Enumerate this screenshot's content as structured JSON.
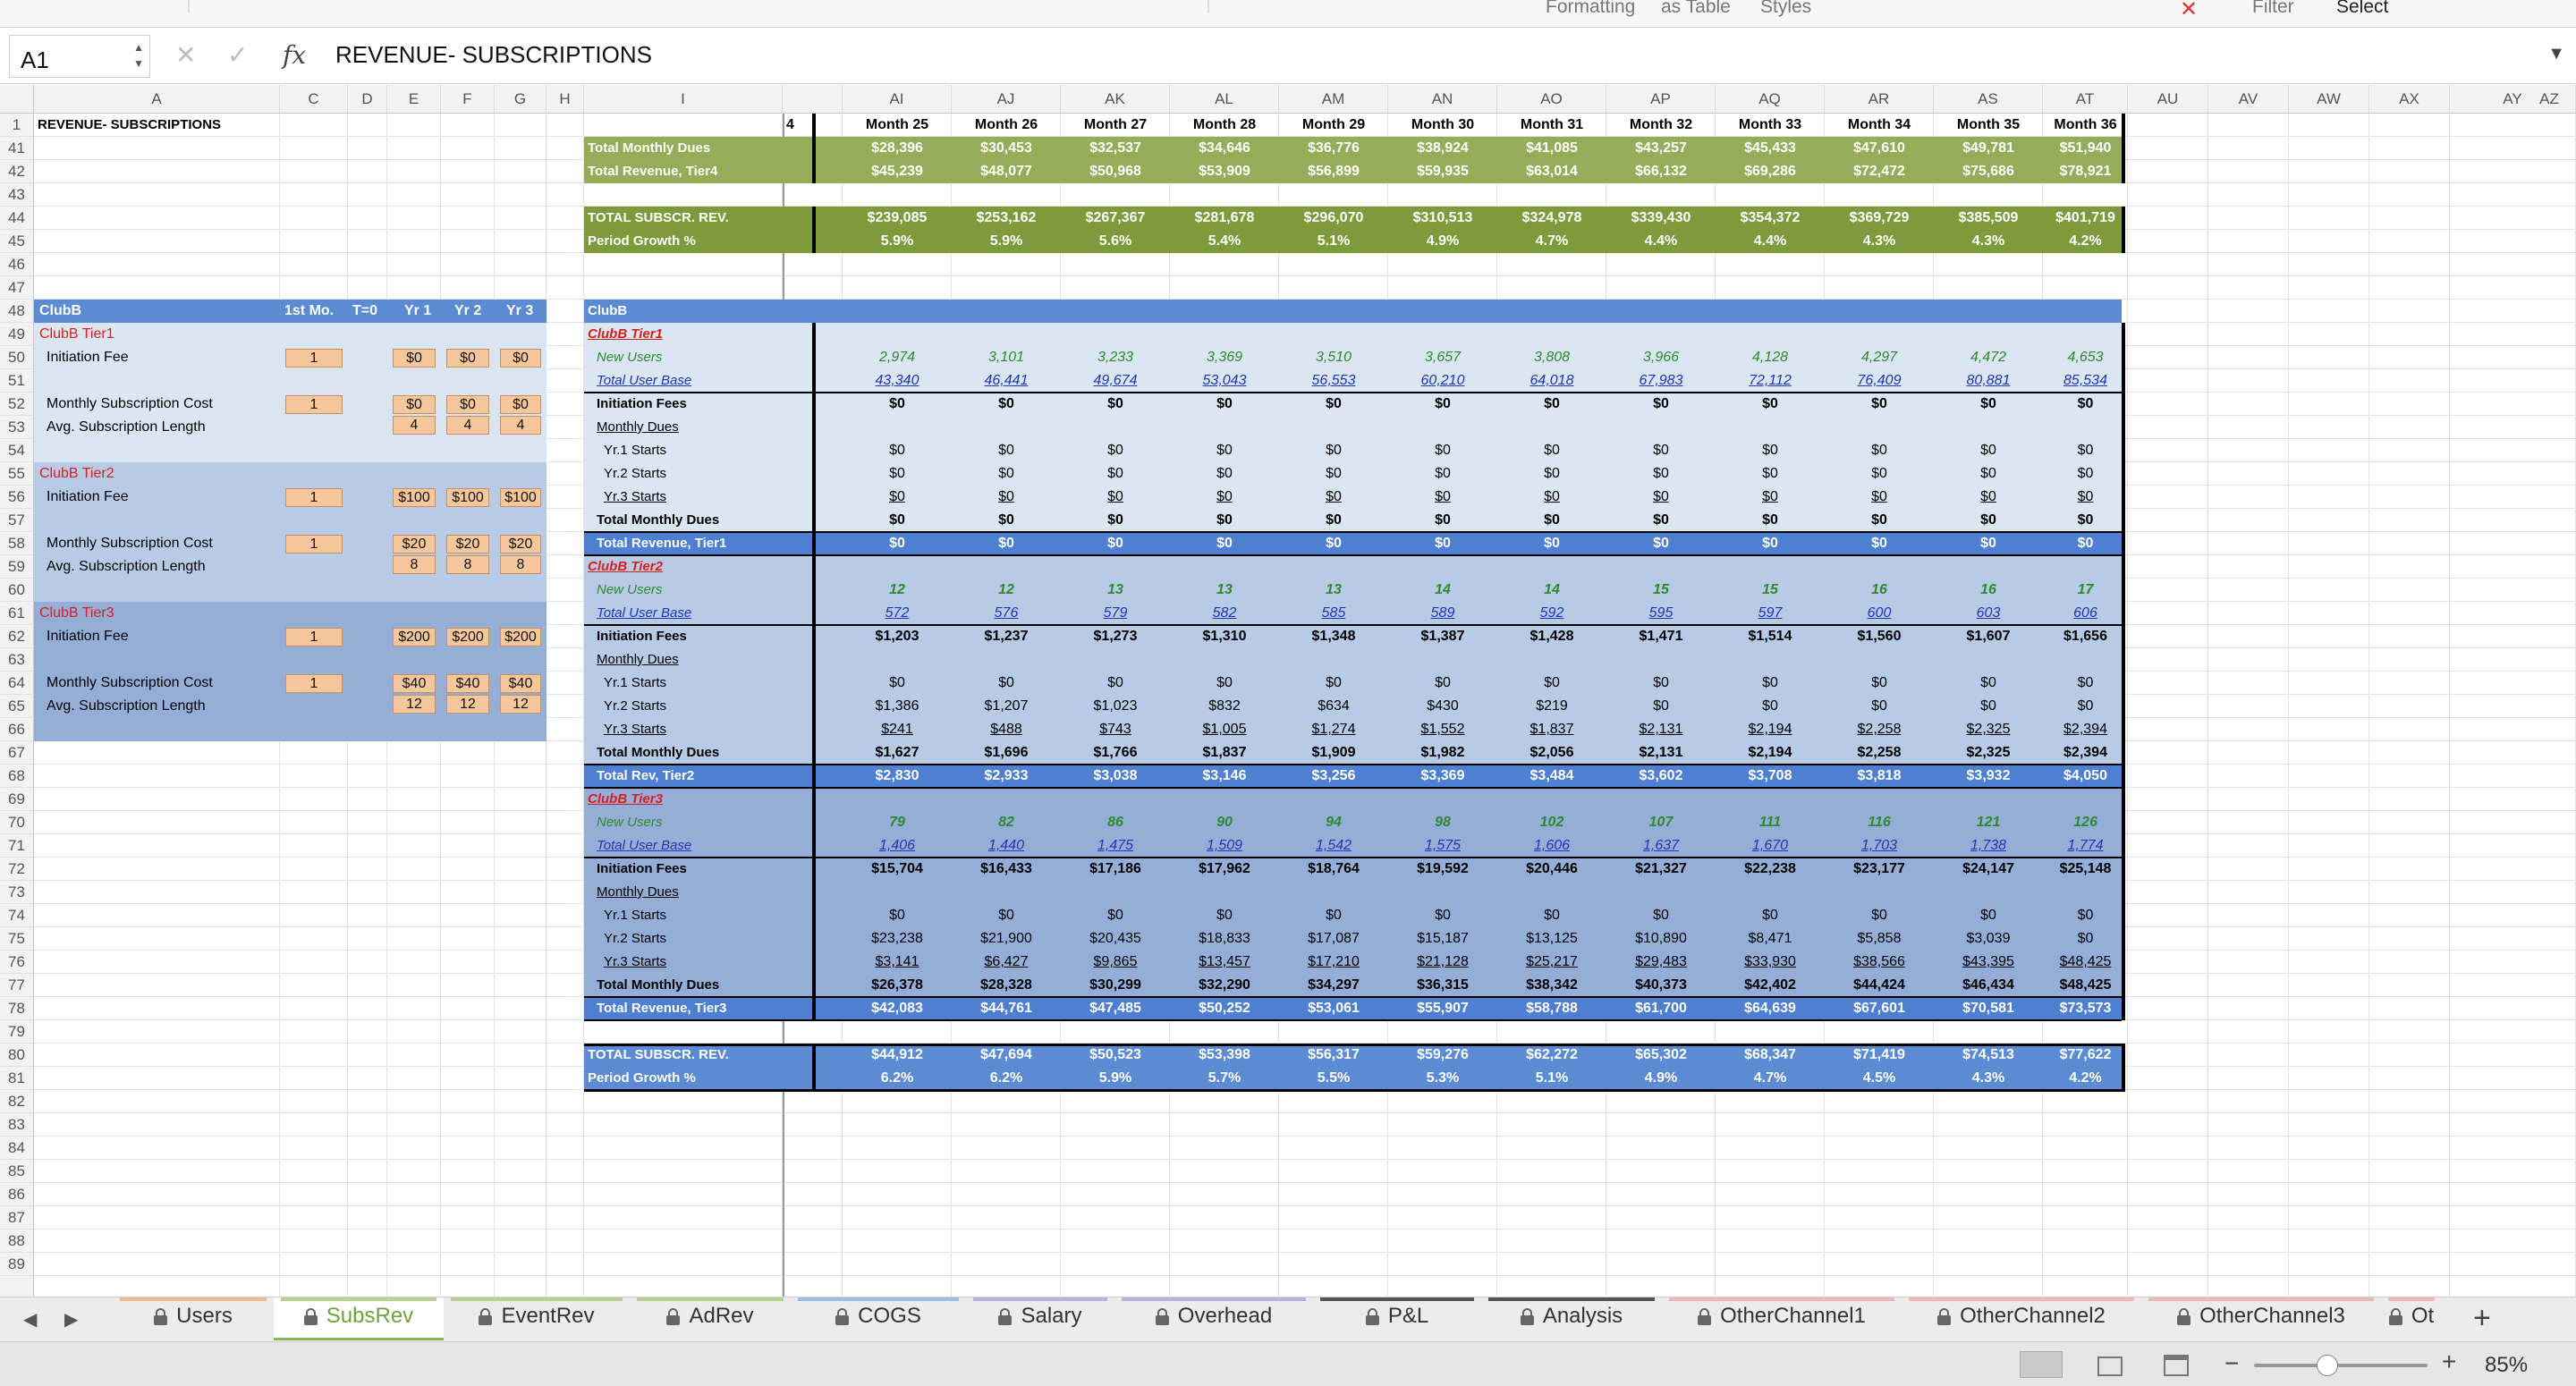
{
  "ribbon": {
    "formatting": "Formatting",
    "as_table": "as Table",
    "styles": "Styles",
    "filter": "Filter",
    "select": "Select"
  },
  "formula_bar": {
    "name_box": "A1",
    "formula": "REVENUE- SUBSCRIPTIONS"
  },
  "columns": [
    "A",
    "C",
    "D",
    "E",
    "F",
    "G",
    "H",
    "I",
    "AI",
    "AJ",
    "AK",
    "AL",
    "AM",
    "AN",
    "AO",
    "AP",
    "AQ",
    "AR",
    "AS",
    "AT",
    "AU",
    "AV",
    "AW",
    "AX",
    "AY",
    "AZ"
  ],
  "rows": [
    "1",
    "41",
    "42",
    "43",
    "44",
    "45",
    "46",
    "47",
    "48",
    "49",
    "50",
    "51",
    "52",
    "53",
    "54",
    "55",
    "56",
    "57",
    "58",
    "59",
    "60",
    "61",
    "62",
    "63",
    "64",
    "65",
    "66",
    "67",
    "68",
    "69",
    "70",
    "71",
    "72",
    "73",
    "74",
    "75",
    "76",
    "77",
    "78",
    "79",
    "80",
    "81",
    "82",
    "83",
    "84",
    "85",
    "86",
    "87",
    "88",
    "89"
  ],
  "sheet_title": "REVENUE- SUBSCRIPTIONS",
  "headers": {
    "months": [
      "Month 25",
      "Month 26",
      "Month 27",
      "Month 28",
      "Month 29",
      "Month 30",
      "Month 31",
      "Month 32",
      "Month 33",
      "Month 34",
      "Month 35",
      "Month 36"
    ],
    "col_h_label": "4"
  },
  "left_panel": {
    "title": "ClubB",
    "col_1st": "1st Mo.",
    "col_t0": "T=0",
    "col_yr1": "Yr 1",
    "col_yr2": "Yr 2",
    "col_yr3": "Yr 3",
    "tier1": "ClubB Tier1",
    "tier2": "ClubB Tier2",
    "tier3": "ClubB Tier3",
    "init_fee": "Initiation Fee",
    "monthly_cost": "Monthly Subscription Cost",
    "avg_length": "Avg. Subscription Length",
    "t1": {
      "init": [
        "1",
        "$0",
        "$0",
        "$0"
      ],
      "monthly": [
        "1",
        "$0",
        "$0",
        "$0"
      ],
      "length": [
        "4",
        "4",
        "4"
      ]
    },
    "t2": {
      "init": [
        "1",
        "$100",
        "$100",
        "$100"
      ],
      "monthly": [
        "1",
        "$20",
        "$20",
        "$20"
      ],
      "length": [
        "8",
        "8",
        "8"
      ]
    },
    "t3": {
      "init": [
        "1",
        "$200",
        "$200",
        "$200"
      ],
      "monthly": [
        "1",
        "$40",
        "$40",
        "$40"
      ],
      "length": [
        "12",
        "12",
        "12"
      ]
    }
  },
  "labels": {
    "r41": "Total Monthly Dues",
    "r42": "Total Revenue, Tier4",
    "r44": "TOTAL SUBSCR. REV.",
    "r45": "Period Growth %",
    "r48": "ClubB",
    "r49": "ClubB Tier1",
    "r50": "New Users",
    "r51": "Total User Base",
    "r52": "Initiation Fees",
    "r53": "Monthly Dues",
    "r54": "Yr.1 Starts",
    "r55": "Yr.2 Starts",
    "r56": "Yr.3 Starts",
    "r57": "Total Monthly Dues",
    "r58": "Total Revenue, Tier1",
    "r59": "ClubB Tier2",
    "r60": "New Users",
    "r61": "Total User Base",
    "r62": "Initiation Fees",
    "r63": "Monthly Dues",
    "r64": "Yr.1 Starts",
    "r65": "Yr.2 Starts",
    "r66": "Yr.3 Starts",
    "r67": "Total Monthly Dues",
    "r68": "Total Rev, Tier2",
    "r69": "ClubB Tier3",
    "r70": "New Users",
    "r71": "Total User Base",
    "r72": "Initiation Fees",
    "r73": "Monthly Dues",
    "r74": "Yr.1 Starts",
    "r75": "Yr.2 Starts",
    "r76": "Yr.3 Starts",
    "r77": "Total Monthly Dues",
    "r78": "Total Revenue, Tier3",
    "r80": "TOTAL SUBSCR. REV.",
    "r81": "Period Growth %"
  },
  "values": {
    "r41": [
      "$28,396",
      "$30,453",
      "$32,537",
      "$34,646",
      "$36,776",
      "$38,924",
      "$41,085",
      "$43,257",
      "$45,433",
      "$47,610",
      "$49,781",
      "$51,940"
    ],
    "r42": [
      "$45,239",
      "$48,077",
      "$50,968",
      "$53,909",
      "$56,899",
      "$59,935",
      "$63,014",
      "$66,132",
      "$69,286",
      "$72,472",
      "$75,686",
      "$78,921"
    ],
    "r44": [
      "$239,085",
      "$253,162",
      "$267,367",
      "$281,678",
      "$296,070",
      "$310,513",
      "$324,978",
      "$339,430",
      "$354,372",
      "$369,729",
      "$385,509",
      "$401,719"
    ],
    "r45": [
      "5.9%",
      "5.9%",
      "5.6%",
      "5.4%",
      "5.1%",
      "4.9%",
      "4.7%",
      "4.4%",
      "4.4%",
      "4.3%",
      "4.3%",
      "4.2%"
    ],
    "r50": [
      "2,974",
      "3,101",
      "3,233",
      "3,369",
      "3,510",
      "3,657",
      "3,808",
      "3,966",
      "4,128",
      "4,297",
      "4,472",
      "4,653"
    ],
    "r51": [
      "43,340",
      "46,441",
      "49,674",
      "53,043",
      "56,553",
      "60,210",
      "64,018",
      "67,983",
      "72,112",
      "76,409",
      "80,881",
      "85,534"
    ],
    "r52": [
      "$0",
      "$0",
      "$0",
      "$0",
      "$0",
      "$0",
      "$0",
      "$0",
      "$0",
      "$0",
      "$0",
      "$0"
    ],
    "r54": [
      "$0",
      "$0",
      "$0",
      "$0",
      "$0",
      "$0",
      "$0",
      "$0",
      "$0",
      "$0",
      "$0",
      "$0"
    ],
    "r55": [
      "$0",
      "$0",
      "$0",
      "$0",
      "$0",
      "$0",
      "$0",
      "$0",
      "$0",
      "$0",
      "$0",
      "$0"
    ],
    "r56": [
      "$0",
      "$0",
      "$0",
      "$0",
      "$0",
      "$0",
      "$0",
      "$0",
      "$0",
      "$0",
      "$0",
      "$0"
    ],
    "r57": [
      "$0",
      "$0",
      "$0",
      "$0",
      "$0",
      "$0",
      "$0",
      "$0",
      "$0",
      "$0",
      "$0",
      "$0"
    ],
    "r58": [
      "$0",
      "$0",
      "$0",
      "$0",
      "$0",
      "$0",
      "$0",
      "$0",
      "$0",
      "$0",
      "$0",
      "$0"
    ],
    "r60": [
      "12",
      "12",
      "13",
      "13",
      "13",
      "14",
      "14",
      "15",
      "15",
      "16",
      "16",
      "17"
    ],
    "r61": [
      "572",
      "576",
      "579",
      "582",
      "585",
      "589",
      "592",
      "595",
      "597",
      "600",
      "603",
      "606"
    ],
    "r62": [
      "$1,203",
      "$1,237",
      "$1,273",
      "$1,310",
      "$1,348",
      "$1,387",
      "$1,428",
      "$1,471",
      "$1,514",
      "$1,560",
      "$1,607",
      "$1,656"
    ],
    "r64": [
      "$0",
      "$0",
      "$0",
      "$0",
      "$0",
      "$0",
      "$0",
      "$0",
      "$0",
      "$0",
      "$0",
      "$0"
    ],
    "r65": [
      "$1,386",
      "$1,207",
      "$1,023",
      "$832",
      "$634",
      "$430",
      "$219",
      "$0",
      "$0",
      "$0",
      "$0",
      "$0"
    ],
    "r66": [
      "$241",
      "$488",
      "$743",
      "$1,005",
      "$1,274",
      "$1,552",
      "$1,837",
      "$2,131",
      "$2,194",
      "$2,258",
      "$2,325",
      "$2,394"
    ],
    "r67": [
      "$1,627",
      "$1,696",
      "$1,766",
      "$1,837",
      "$1,909",
      "$1,982",
      "$2,056",
      "$2,131",
      "$2,194",
      "$2,258",
      "$2,325",
      "$2,394"
    ],
    "r68": [
      "$2,830",
      "$2,933",
      "$3,038",
      "$3,146",
      "$3,256",
      "$3,369",
      "$3,484",
      "$3,602",
      "$3,708",
      "$3,818",
      "$3,932",
      "$4,050"
    ],
    "r70": [
      "79",
      "82",
      "86",
      "90",
      "94",
      "98",
      "102",
      "107",
      "111",
      "116",
      "121",
      "126"
    ],
    "r71": [
      "1,406",
      "1,440",
      "1,475",
      "1,509",
      "1,542",
      "1,575",
      "1,606",
      "1,637",
      "1,670",
      "1,703",
      "1,738",
      "1,774"
    ],
    "r72": [
      "$15,704",
      "$16,433",
      "$17,186",
      "$17,962",
      "$18,764",
      "$19,592",
      "$20,446",
      "$21,327",
      "$22,238",
      "$23,177",
      "$24,147",
      "$25,148"
    ],
    "r74": [
      "$0",
      "$0",
      "$0",
      "$0",
      "$0",
      "$0",
      "$0",
      "$0",
      "$0",
      "$0",
      "$0",
      "$0"
    ],
    "r75": [
      "$23,238",
      "$21,900",
      "$20,435",
      "$18,833",
      "$17,087",
      "$15,187",
      "$13,125",
      "$10,890",
      "$8,471",
      "$5,858",
      "$3,039",
      "$0"
    ],
    "r76": [
      "$3,141",
      "$6,427",
      "$9,865",
      "$13,457",
      "$17,210",
      "$21,128",
      "$25,217",
      "$29,483",
      "$33,930",
      "$38,566",
      "$43,395",
      "$48,425"
    ],
    "r77": [
      "$26,378",
      "$28,328",
      "$30,299",
      "$32,290",
      "$34,297",
      "$36,315",
      "$38,342",
      "$40,373",
      "$42,402",
      "$44,424",
      "$46,434",
      "$48,425"
    ],
    "r78": [
      "$42,083",
      "$44,761",
      "$47,485",
      "$50,252",
      "$53,061",
      "$55,907",
      "$58,788",
      "$61,700",
      "$64,639",
      "$67,601",
      "$70,581",
      "$73,573"
    ],
    "r80": [
      "$44,912",
      "$47,694",
      "$50,523",
      "$53,398",
      "$56,317",
      "$59,276",
      "$62,272",
      "$65,302",
      "$68,347",
      "$71,419",
      "$74,513",
      "$77,622"
    ],
    "r81": [
      "6.2%",
      "6.2%",
      "5.9%",
      "5.7%",
      "5.5%",
      "5.3%",
      "5.1%",
      "4.9%",
      "4.7%",
      "4.5%",
      "4.3%",
      "4.2%"
    ]
  },
  "sheet_tabs": [
    "Users",
    "SubsRev",
    "EventRev",
    "AdRev",
    "COGS",
    "Salary",
    "Overhead",
    "P&L",
    "Analysis",
    "OtherChannel1",
    "OtherChannel2",
    "OtherChannel3",
    "Ot"
  ],
  "active_tab": "SubsRev",
  "tab_colors": [
    "#f2b896",
    "#b6d28d",
    "#b6d28d",
    "#b6d28d",
    "#9dbde8",
    "#b3b3df",
    "#b3b3df",
    "#555555",
    "#555555",
    "#f0b8b8",
    "#f0b8b8",
    "#f0b8b8",
    "#f0b8b8"
  ],
  "status": {
    "zoom": "85%"
  }
}
